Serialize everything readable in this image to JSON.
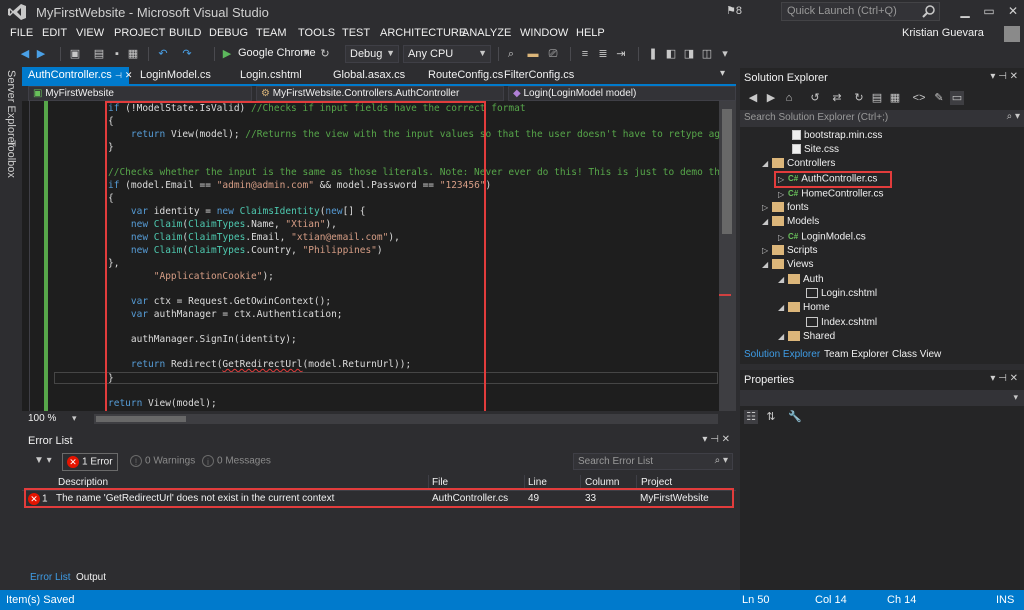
{
  "window": {
    "title": "MyFirstWebsite - Microsoft Visual Studio",
    "notifications": "8",
    "quick_launch_placeholder": "Quick Launch (Ctrl+Q)"
  },
  "menu": [
    "FILE",
    "EDIT",
    "VIEW",
    "PROJECT",
    "BUILD",
    "DEBUG",
    "TEAM",
    "TOOLS",
    "TEST",
    "ARCHITECTURE",
    "ANALYZE",
    "WINDOW",
    "HELP"
  ],
  "user": {
    "name": "Kristian Guevara"
  },
  "toolbar": {
    "browser": "Google Chrome",
    "configuration": "Debug",
    "platform": "Any CPU"
  },
  "left_strip": {
    "server_explorer": "Server Explorer",
    "toolbox": "Toolbox"
  },
  "doc_tabs": [
    "AuthController.cs",
    "LoginModel.cs",
    "Login.cshtml",
    "Global.asax.cs",
    "RouteConfig.cs",
    "FilterConfig.cs"
  ],
  "nav": {
    "project": "MyFirstWebsite",
    "class": "MyFirstWebsite.Controllers.AuthController",
    "member": "Login(LoginModel model)"
  },
  "editor": {
    "zoom": "100 %"
  },
  "error_list": {
    "title": "Error List",
    "errors_btn": "1 Error",
    "warnings_btn": "0 Warnings",
    "messages_btn": "0 Messages",
    "search_placeholder": "Search Error List",
    "columns": {
      "description": "Description",
      "file": "File",
      "line": "Line",
      "column": "Column",
      "project": "Project"
    },
    "row": {
      "num": "1",
      "description": "The name 'GetRedirectUrl' does not exist in the current context",
      "file": "AuthController.cs",
      "line": "49",
      "column": "33",
      "project": "MyFirstWebsite"
    },
    "tabs": {
      "errors": "Error List",
      "output": "Output"
    }
  },
  "solution_explorer": {
    "title": "Solution Explorer",
    "search_placeholder": "Search Solution Explorer (Ctrl+;)",
    "items": {
      "bootstrap": "bootstrap.min.css",
      "site": "Site.css",
      "controllers": "Controllers",
      "auth": "AuthController.cs",
      "home": "HomeController.cs",
      "fonts": "fonts",
      "models": "Models",
      "loginmodel": "LoginModel.cs",
      "scripts": "Scripts",
      "views": "Views",
      "authfolder": "Auth",
      "logincshtml": "Login.cshtml",
      "homefolder": "Home",
      "indexcshtml": "Index.cshtml",
      "shared": "Shared"
    },
    "bottom_tabs": {
      "solution": "Solution Explorer",
      "team": "Team Explorer",
      "classview": "Class View"
    }
  },
  "properties": {
    "title": "Properties"
  },
  "status": {
    "message": "Item(s) Saved",
    "ln": "Ln 50",
    "col": "Col 14",
    "ch": "Ch 14",
    "mode": "INS"
  },
  "colors": {
    "accent": "#007acc",
    "error_highlight": "#e23c3c",
    "background": "#2d2d30"
  }
}
